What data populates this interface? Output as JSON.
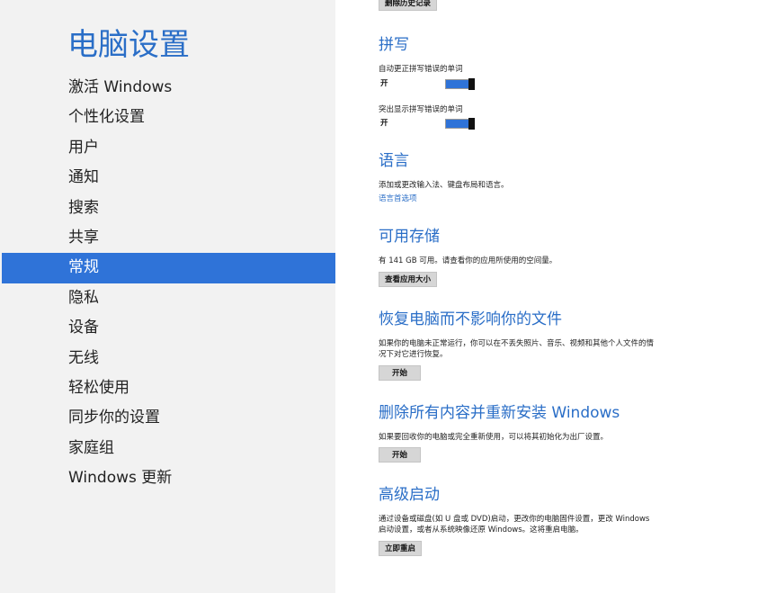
{
  "sidebar": {
    "title": "电脑设置",
    "items": [
      {
        "label": "激活 Windows"
      },
      {
        "label": "个性化设置"
      },
      {
        "label": "用户"
      },
      {
        "label": "通知"
      },
      {
        "label": "搜索"
      },
      {
        "label": "共享"
      },
      {
        "label": "常规",
        "selected": true
      },
      {
        "label": "隐私"
      },
      {
        "label": "设备"
      },
      {
        "label": "无线"
      },
      {
        "label": "轻松使用"
      },
      {
        "label": "同步你的设置"
      },
      {
        "label": "家庭组"
      },
      {
        "label": "Windows 更新"
      }
    ]
  },
  "main": {
    "top_button": "删除历史记录",
    "spelling": {
      "heading": "拼写",
      "autocorrect_label": "自动更正拼写错误的单词",
      "autocorrect_state": "开",
      "highlight_label": "突出显示拼写错误的单词",
      "highlight_state": "开"
    },
    "language": {
      "heading": "语言",
      "description": "添加或更改输入法、键盘布局和语言。",
      "link": "语言首选项"
    },
    "storage": {
      "heading": "可用存储",
      "description": "有 141 GB 可用。请查看你的应用所使用的空间量。",
      "button": "查看应用大小"
    },
    "refresh": {
      "heading": "恢复电脑而不影响你的文件",
      "description_line1": "如果你的电脑未正常运行，你可以在不丢失照片、音乐、视频和其他个人文件的情",
      "description_line2": "况下对它进行恢复。",
      "button": "开始"
    },
    "reset": {
      "heading": "删除所有内容并重新安装 Windows",
      "description": "如果要回收你的电脑或完全重新使用，可以将其初始化为出厂设置。",
      "button": "开始"
    },
    "advanced": {
      "heading": "高级启动",
      "description_line1": "通过设备或磁盘(如 U 盘或 DVD)启动，更改你的电脑固件设置，更改 Windows",
      "description_line2": "启动设置，或者从系统映像还原 Windows。这将重启电脑。",
      "button": "立即重启"
    }
  },
  "colors": {
    "accent": "#2f73d8",
    "heading": "#2a6ec7",
    "sidebar_bg": "#f2f2f2"
  }
}
